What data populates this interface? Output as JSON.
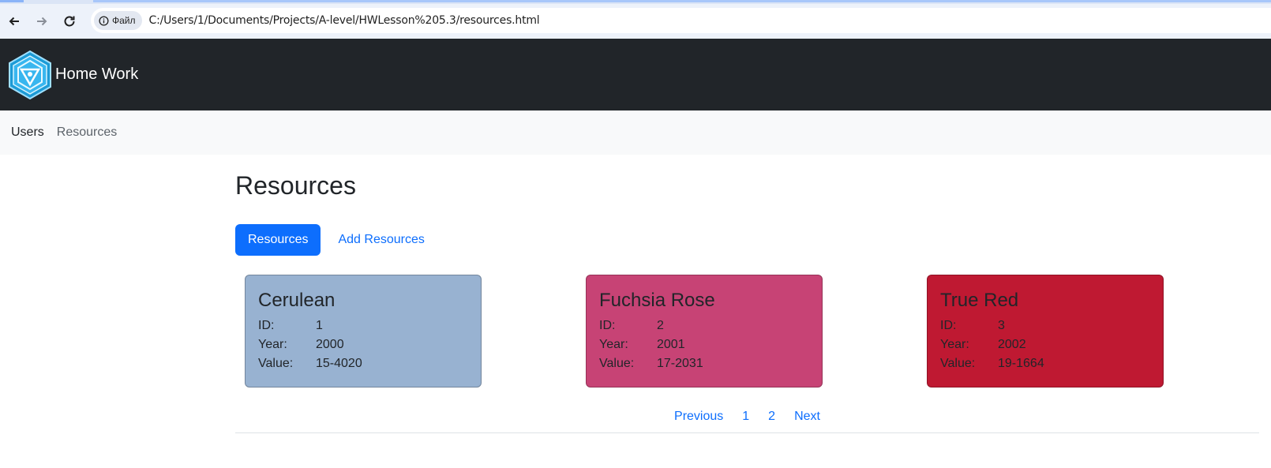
{
  "browser": {
    "site_chip_label": "Файл",
    "url": "C:/Users/1/Documents/Projects/A-level/HWLesson%205.3/resources.html"
  },
  "navbar": {
    "brand": "Home Work"
  },
  "subnav": {
    "items": [
      {
        "label": "Users"
      },
      {
        "label": "Resources"
      }
    ]
  },
  "page": {
    "title": "Resources",
    "tabs": [
      {
        "label": "Resources",
        "active": true
      },
      {
        "label": "Add Resources",
        "active": false
      }
    ]
  },
  "resources": [
    {
      "name": "Cerulean",
      "id_label": "ID:",
      "id": "1",
      "year_label": "Year:",
      "year": "2000",
      "value_label": "Value:",
      "value": "15-4020",
      "color": "#98B2D1"
    },
    {
      "name": "Fuchsia Rose",
      "id_label": "ID:",
      "id": "2",
      "year_label": "Year:",
      "year": "2001",
      "value_label": "Value:",
      "value": "17-2031",
      "color": "#C74375"
    },
    {
      "name": "True Red",
      "id_label": "ID:",
      "id": "3",
      "year_label": "Year:",
      "year": "2002",
      "value_label": "Value:",
      "value": "19-1664",
      "color": "#BF1932"
    }
  ],
  "pagination": {
    "previous": "Previous",
    "pages": [
      "1",
      "2"
    ],
    "next": "Next"
  }
}
